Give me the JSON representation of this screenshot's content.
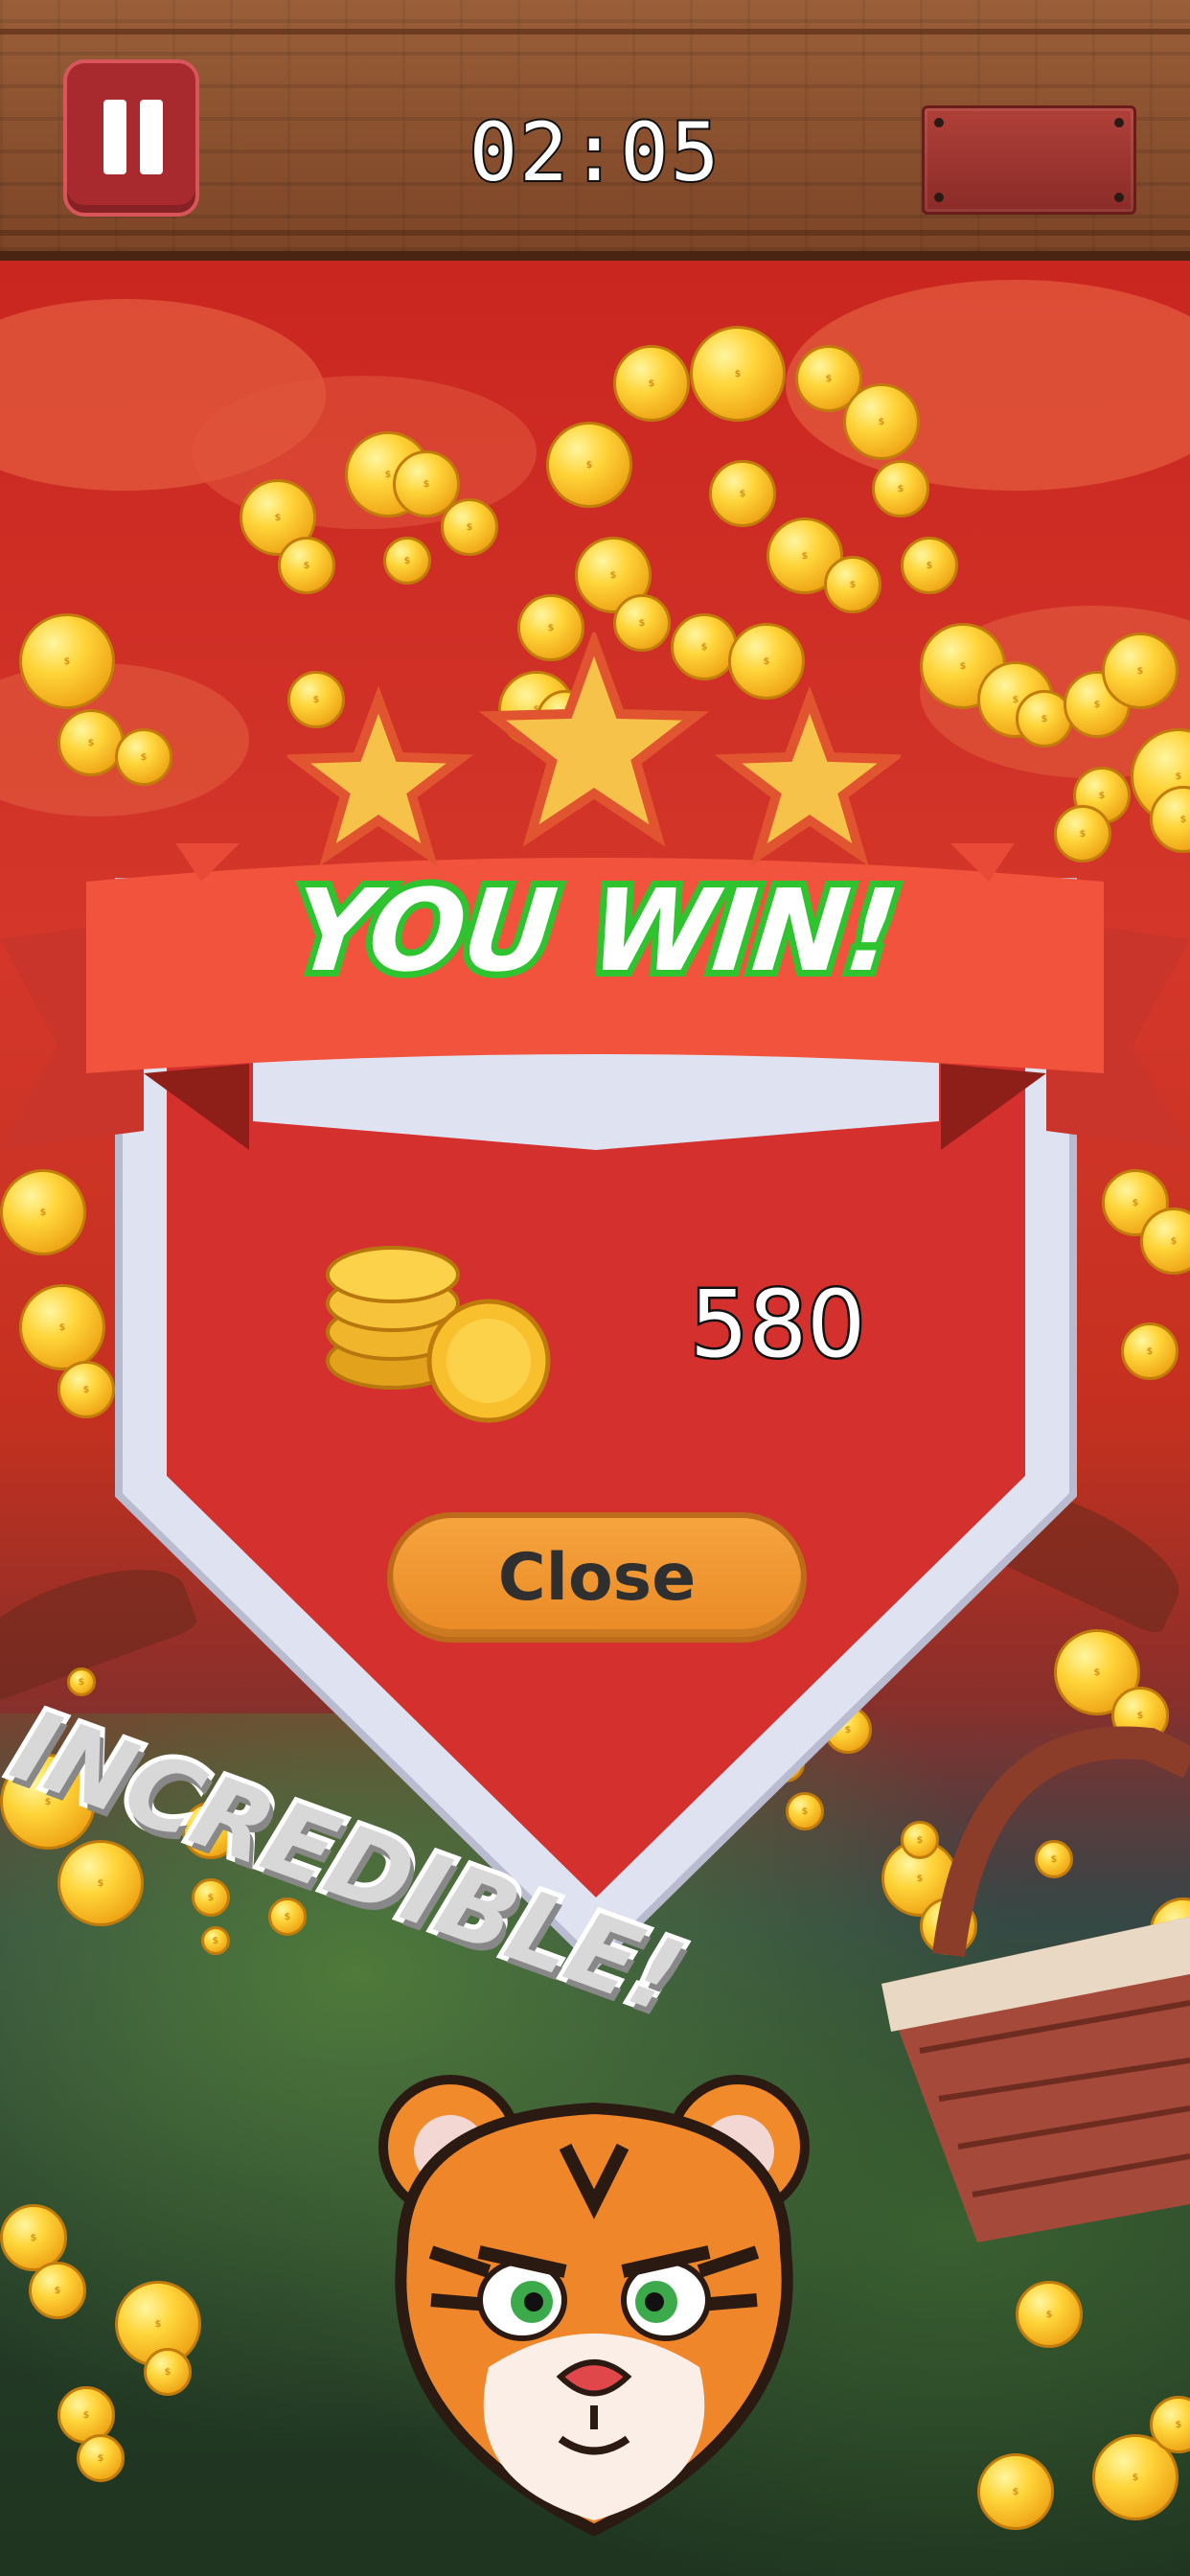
{
  "header": {
    "timer": "02:05"
  },
  "result": {
    "title": "YOU WIN!",
    "stars_earned": 3,
    "stars_total": 3,
    "reward_amount": "580",
    "close_label": "Close",
    "praise": "INCREDIBLE!"
  },
  "colors": {
    "banner_red": "#e84a37",
    "title_green": "#2fc42f",
    "button_orange": "#f39a34",
    "star_gold": "#f7c24a"
  },
  "icons": [
    "pause-icon",
    "star-icon",
    "coin-stack-icon",
    "coin-icon",
    "basket-icon",
    "tiger-mascot"
  ]
}
